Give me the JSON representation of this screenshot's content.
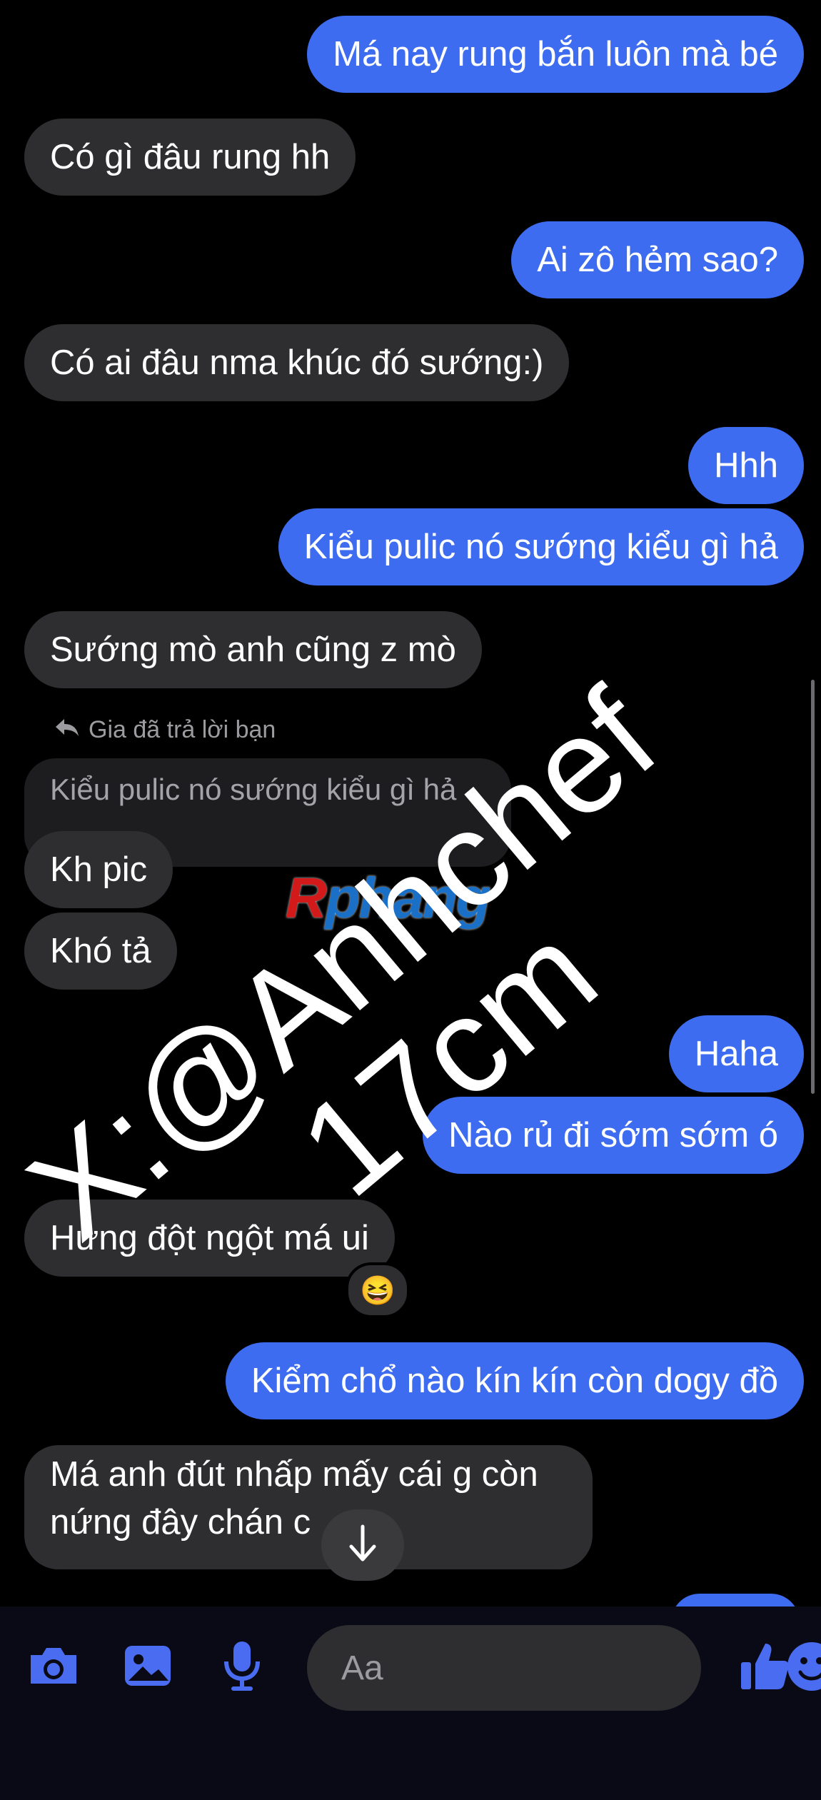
{
  "messages": {
    "m1": "Má nay rung bắn luôn mà bé",
    "m2": "Có gì đâu rung hh",
    "m3": "Ai zô hẻm sao?",
    "m4": "Có ai đâu nma khúc đó sướng:)",
    "m5": "Hhh",
    "m6": "Kiểu pulic nó sướng kiểu gì hả",
    "m7": "Sướng mò anh cũng z mò",
    "reply_meta": "Gia đã trả lời bạn",
    "replied_quote": "Kiểu pulic nó sướng kiểu gì hả",
    "m8": "Kh pic",
    "m9": "Khó tả",
    "m10": "Haha",
    "m11": "Nào rủ đi sớm sớm ó",
    "m12": "Hứng đột ngột má ui",
    "reaction": "😆",
    "m13": "Kiểm chổ nào kín kín còn dogy đồ",
    "m14": "Má anh đút nhấp mấy cái g còn nứng đây chán c"
  },
  "composer": {
    "placeholder": "Aa"
  },
  "toolbar": {
    "icons": [
      "camera-icon",
      "image-icon",
      "microphone-icon",
      "emoji-icon",
      "thumbs-up-icon"
    ]
  },
  "watermark": {
    "logo_r": "R",
    "logo_rest": "phang",
    "line1": "X:@Anhchef",
    "line2": "17cm"
  },
  "colors": {
    "outgoing": "#3e6cf0",
    "incoming": "#2e2e30",
    "accent": "#4a6cf0",
    "background": "#000000"
  }
}
